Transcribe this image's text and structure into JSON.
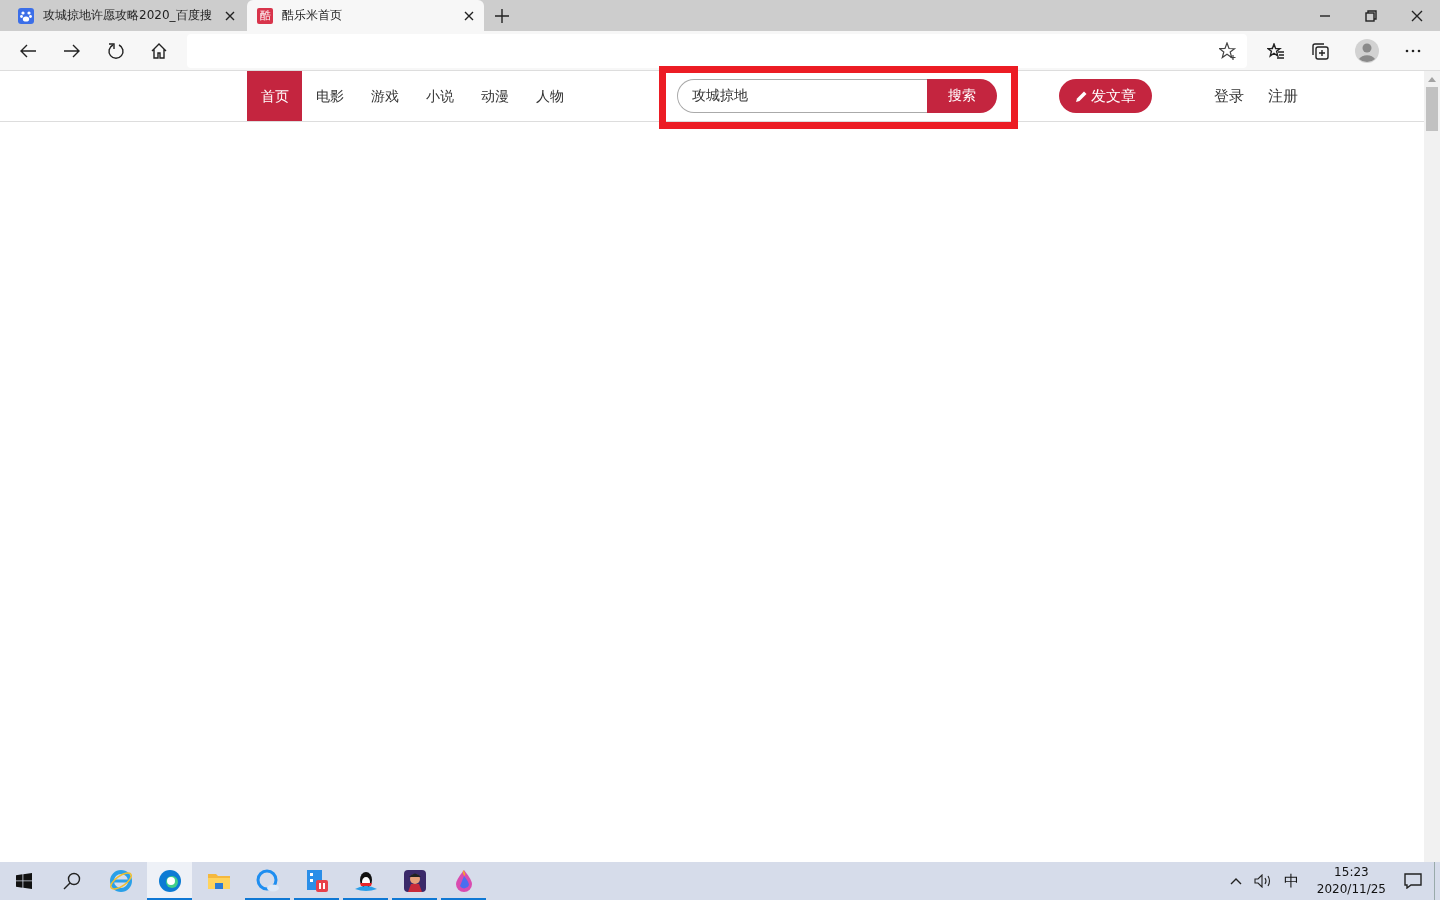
{
  "browser": {
    "tabs": [
      {
        "title": "攻城掠地许愿攻略2020_百度搜",
        "kind": "paw",
        "selected": false
      },
      {
        "title": "酷乐米首页",
        "kind": "letter",
        "favicon_text": "酷",
        "selected": true
      }
    ]
  },
  "page": {
    "nav": [
      {
        "label": "首页",
        "selected": true
      },
      {
        "label": "电影",
        "selected": false
      },
      {
        "label": "游戏",
        "selected": false
      },
      {
        "label": "小说",
        "selected": false
      },
      {
        "label": "动漫",
        "selected": false
      },
      {
        "label": "人物",
        "selected": false
      }
    ],
    "search": {
      "value": "攻城掠地",
      "button": "搜索"
    },
    "post_button": "发文章",
    "links": [
      "登录",
      "注册"
    ]
  },
  "taskbar": {
    "apps": [
      {
        "kind": "ie",
        "running": false,
        "active": false
      },
      {
        "kind": "edge",
        "running": true,
        "active": true
      },
      {
        "kind": "folder",
        "running": false,
        "active": false
      },
      {
        "kind": "chat",
        "running": true,
        "active": false
      },
      {
        "kind": "video",
        "running": true,
        "active": false
      },
      {
        "kind": "penguin",
        "running": true,
        "active": false
      },
      {
        "kind": "game",
        "running": true,
        "active": false
      },
      {
        "kind": "drop",
        "running": true,
        "active": false
      }
    ],
    "ime": "中",
    "time": "15:23",
    "date": "2020/11/25"
  }
}
